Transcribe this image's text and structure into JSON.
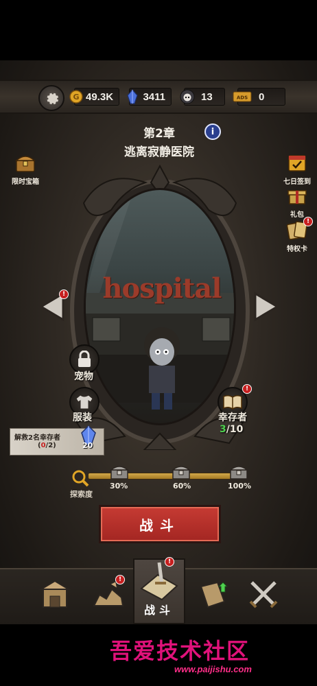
{
  "resources": {
    "gold": "49.3K",
    "crystal": "3411",
    "skull": "13",
    "ticket": "0",
    "ticket_icon_text": "ADS"
  },
  "chapter": {
    "number": "第2章",
    "name": "逃离寂静医院",
    "info_glyph": "i"
  },
  "left_side": {
    "chest_label": "限时宝箱"
  },
  "right_side": {
    "signin_label": "七日签到",
    "gift_label": "礼包",
    "card_label": "特权卡"
  },
  "mirror": {
    "scene_text": "hospital"
  },
  "buttons": {
    "pet_label": "宠物",
    "clothing_label": "服装",
    "survivor_label": "幸存者",
    "survivor_current": "3",
    "survivor_total": "/10",
    "fight_label": "战斗"
  },
  "rescue": {
    "title": "解救2名幸存者",
    "paren_open": "(",
    "current": "0",
    "rest": "/2)",
    "reward": "20"
  },
  "progress": {
    "label": "探索度",
    "value_percent": 0,
    "milestones": [
      "30%",
      "60%",
      "100%"
    ]
  },
  "nav": {
    "active_label": "战斗"
  },
  "watermark": {
    "text": "吾爱技术社区",
    "url": "www.paijishu.com"
  },
  "colors": {
    "fight_red": "#c63b33",
    "badge_red": "#c61f1f",
    "survivor_green": "#4fd14f",
    "watermark_pink": "#e0127a"
  }
}
